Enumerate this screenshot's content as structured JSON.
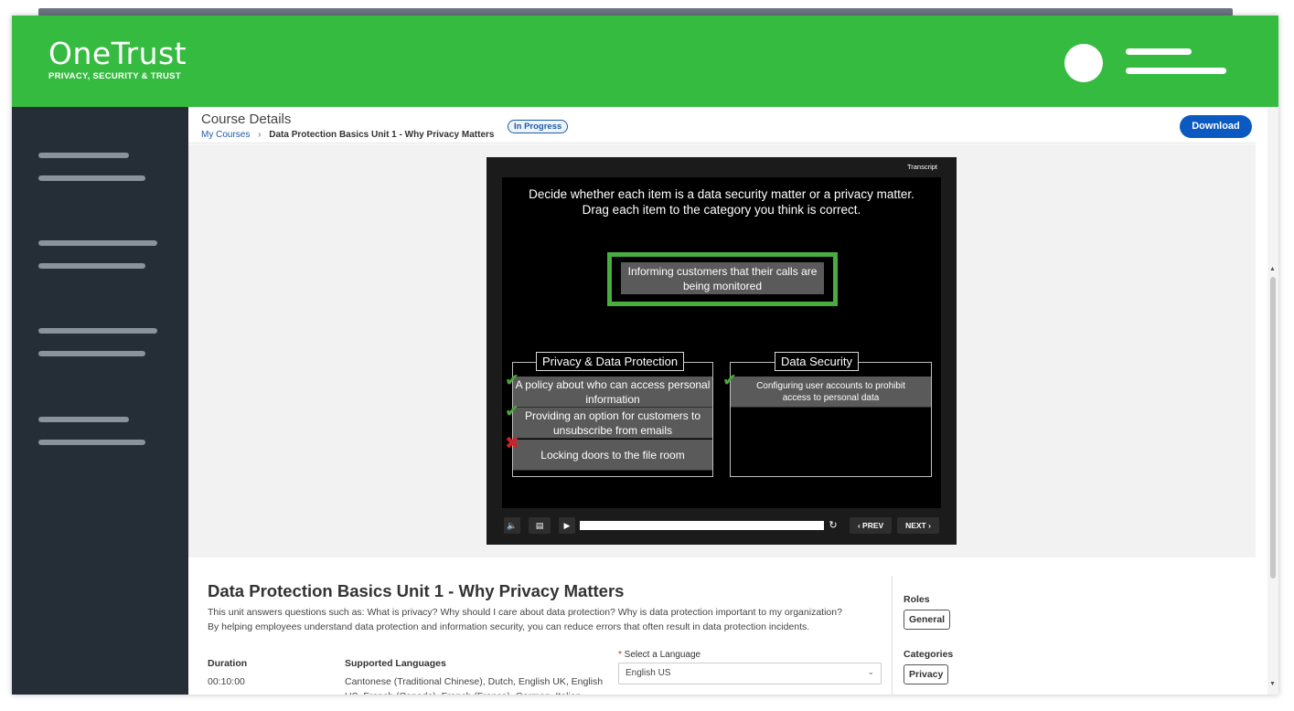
{
  "header": {
    "brand_name": "OneTrust",
    "brand_tagline": "PRIVACY, SECURITY & TRUST",
    "color": "#36bb41"
  },
  "topbar": {
    "page_title": "Course Details",
    "breadcrumb_home": "My Courses",
    "breadcrumb_sep": "›",
    "breadcrumb_current": "Data Protection Basics Unit 1 - Why Privacy Matters",
    "status": "In Progress",
    "download_label": "Download"
  },
  "player": {
    "transcript_label": "Transcript",
    "instructions_line1": "Decide whether each item is a data security matter or a privacy matter.",
    "instructions_line2": "Drag each item to the category you think is correct.",
    "drag_item": "Informing customers that their calls are being monitored",
    "categories": [
      {
        "title": "Privacy & Data Protection",
        "items": [
          {
            "text": "A policy about who can access personal information",
            "result": "check-icon"
          },
          {
            "text": "Providing an option for customers to unsubscribe from emails",
            "result": "check-icon"
          },
          {
            "text": "Locking doors to the file room",
            "result": "cross-icon"
          }
        ]
      },
      {
        "title": "Data Security",
        "items": [
          {
            "text": "Configuring user accounts to prohibit access to personal data",
            "result": "check-icon"
          }
        ]
      }
    ],
    "controls": {
      "volume_icon": "volume-icon",
      "captions_icon": "captions-icon",
      "play_icon": "play-icon",
      "replay_icon": "replay-icon",
      "prev_label": "‹ PREV",
      "next_label": "NEXT ›"
    }
  },
  "course": {
    "title": "Data Protection Basics Unit 1 - Why Privacy Matters",
    "description_line1": "This unit answers questions such as: What is privacy? Why should I care about data protection? Why is data protection important to my organization?",
    "description_line2": "By helping employees understand data protection and information security, you can reduce errors that often result in data protection incidents.",
    "duration_label": "Duration",
    "duration_value": "00:10:00",
    "languages_label": "Supported Languages",
    "languages_value": "Cantonese (Traditional Chinese), Dutch, English UK, English US, French (Canada), French (France), German, Italian",
    "select_label": "Select a Language",
    "select_value": "English US",
    "roles_label": "Roles",
    "roles_value": "General",
    "categories_label": "Categories",
    "categories_value": "Privacy"
  }
}
